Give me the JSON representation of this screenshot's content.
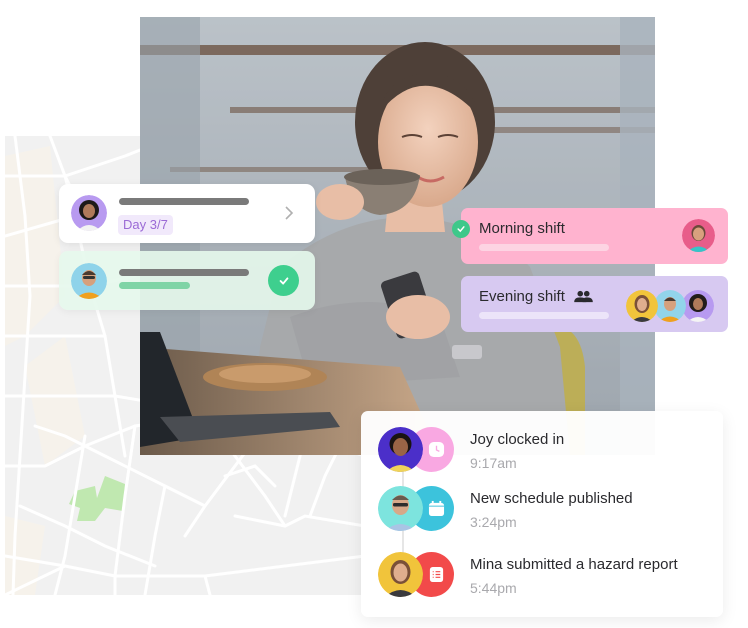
{
  "colors": {
    "map_bg": "#f1f1f1",
    "map_park": "#c0e8b0",
    "map_block": "#f6f2eb",
    "accent_purple": "#9b6ad6",
    "success_green": "#3ecf8e",
    "morning_shift_bg": "#ffb3cf",
    "evening_shift_bg": "#d7c9f1",
    "clock_icon_bg": "#f9a8e2",
    "calendar_icon_bg": "#3cc3dc",
    "report_icon_bg": "#f24a4a"
  },
  "task_card": {
    "avatar_icon": "woman-curly-hair-avatar",
    "badge": "Day 3/7",
    "action_icon": "chevron-right-icon"
  },
  "done_card": {
    "avatar_icon": "man-glasses-avatar",
    "status_icon": "check-icon"
  },
  "shifts": [
    {
      "name": "Morning shift",
      "status_icon": "check-icon",
      "avatars": [
        "woman-avatar-pink"
      ]
    },
    {
      "name": "Evening shift",
      "group_icon": "people-icon",
      "avatars": [
        "woman-avatar-yellow",
        "man-avatar-blue",
        "woman-avatar-purple"
      ]
    }
  ],
  "feed": {
    "items": [
      {
        "title": "Joy clocked in",
        "time": "9:17am",
        "icon": "clock-icon"
      },
      {
        "title": "New schedule published",
        "time": "3:24pm",
        "icon": "calendar-icon"
      },
      {
        "title": "Mina submitted a hazard report",
        "time": "5:44pm",
        "icon": "report-list-icon"
      }
    ]
  }
}
